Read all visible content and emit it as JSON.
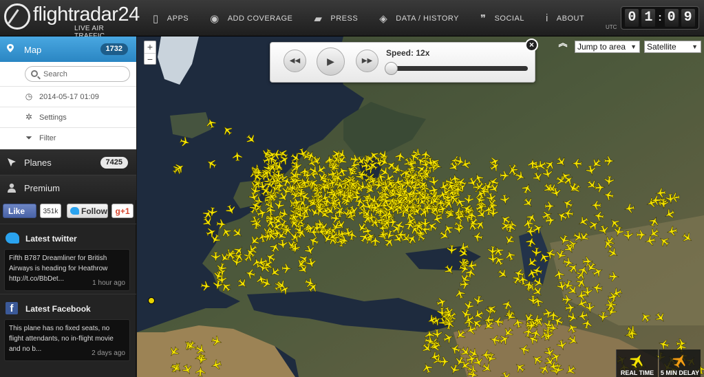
{
  "brand": {
    "name": "flightradar24",
    "tagline": "LIVE AIR TRAFFIC"
  },
  "nav": [
    {
      "label": "APPS",
      "icon": "phone-icon",
      "glyph": "▯"
    },
    {
      "label": "ADD COVERAGE",
      "icon": "eye-icon",
      "glyph": "◉"
    },
    {
      "label": "PRESS",
      "icon": "speech-bubble-icon",
      "glyph": "▰"
    },
    {
      "label": "DATA / HISTORY",
      "icon": "box-icon",
      "glyph": "◈"
    },
    {
      "label": "SOCIAL",
      "icon": "quote-icon",
      "glyph": "❞"
    },
    {
      "label": "ABOUT",
      "icon": "info-icon",
      "glyph": "i"
    }
  ],
  "clock": {
    "zone": "UTC",
    "hh": "01",
    "mm": "09"
  },
  "sidebar": {
    "map": {
      "label": "Map",
      "count": "1732"
    },
    "search_placeholder": "Search",
    "datetime": "2014-05-17 01:09",
    "settings": "Settings",
    "filter": "Filter",
    "planes": {
      "label": "Planes",
      "count": "7425"
    },
    "premium": {
      "label": "Premium"
    },
    "social": {
      "like": "Like",
      "like_count": "351k",
      "follow": "Follow",
      "gplus": "g+1"
    },
    "twitter": {
      "heading": "Latest twitter",
      "text": "Fifth B787 Dreamliner for British Airways is heading for Heathrow http://t.co/BbDet...",
      "time": "1 hour ago"
    },
    "facebook": {
      "heading": "Latest Facebook",
      "text": "This plane has no fixed seats, no flight attendants, no in-flight movie and no b...",
      "time": "2 days ago"
    }
  },
  "player": {
    "speed_label": "Speed: 12x",
    "rewind": "◀◀",
    "play": "▶",
    "forward": "▶▶",
    "close": "×",
    "position": 0.0
  },
  "map_controls": {
    "zoom_in": "+",
    "zoom_out": "−",
    "collapse": "︽",
    "jump_to_area": "Jump to area",
    "map_type": "Satellite",
    "realtime": "REAL TIME",
    "delay": "5 MIN DELAY"
  },
  "colors": {
    "accent": "#2a86c3",
    "plane": "#f5e400",
    "delay_plane": "#f39c12"
  }
}
